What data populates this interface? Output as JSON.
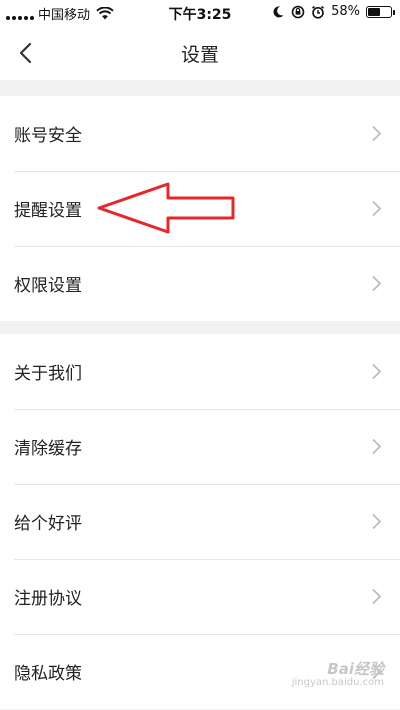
{
  "status_bar": {
    "carrier": "中国移动",
    "time": "下午3:25",
    "battery": "58%",
    "battery_level": 0.58,
    "icons": [
      "signal-icon",
      "wifi-icon",
      "moon-icon",
      "rotation-lock-icon",
      "alarm-icon",
      "battery-icon"
    ]
  },
  "nav": {
    "title": "设置",
    "back_icon": "back-chevron-icon"
  },
  "groups": [
    {
      "items": [
        {
          "label": "账号安全",
          "icon": "chevron-right-icon"
        },
        {
          "label": "提醒设置",
          "icon": "chevron-right-icon"
        },
        {
          "label": "权限设置",
          "icon": "chevron-right-icon"
        }
      ]
    },
    {
      "items": [
        {
          "label": "关于我们",
          "icon": "chevron-right-icon"
        },
        {
          "label": "清除缓存",
          "icon": "chevron-right-icon"
        },
        {
          "label": "给个好评",
          "icon": "chevron-right-icon"
        },
        {
          "label": "注册协议",
          "icon": "chevron-right-icon"
        },
        {
          "label": "隐私政策",
          "icon": "chevron-right-icon"
        }
      ]
    }
  ],
  "annotation": {
    "icon": "red-arrow-icon",
    "color": "#e8262a"
  },
  "watermark": {
    "brand": "Bai经验",
    "url": "jingyan.baidu.com"
  },
  "colors": {
    "background": "#f2f2f2",
    "surface": "#ffffff",
    "divider": "#e6e6e6",
    "chevron": "#bdbdbd",
    "text": "#222222"
  }
}
